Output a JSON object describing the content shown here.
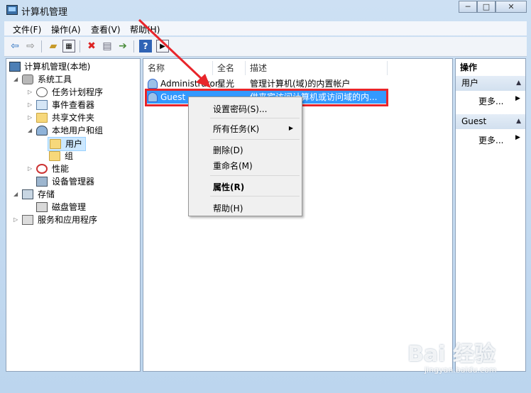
{
  "window": {
    "title": "计算机管理",
    "minimize": "─",
    "maximize": "□",
    "close": "✕"
  },
  "menu": [
    "文件(F)",
    "操作(A)",
    "查看(V)",
    "帮助(H)"
  ],
  "toolbar": [
    "back-arrow-icon",
    "forward-arrow-icon",
    "up-folder-icon",
    "show-tree-icon",
    "delete-icon",
    "properties-icon",
    "export-icon",
    "help-icon",
    "action-pane-icon"
  ],
  "tree": {
    "root": "计算机管理(本地)",
    "system_tools": "系统工具",
    "task_scheduler": "任务计划程序",
    "event_viewer": "事件查看器",
    "shared_folders": "共享文件夹",
    "local_users_groups": "本地用户和组",
    "users": "用户",
    "groups": "组",
    "performance": "性能",
    "device_manager": "设备管理器",
    "storage": "存储",
    "disk_management": "磁盘管理",
    "services_apps": "服务和应用程序"
  },
  "list": {
    "columns": [
      "名称",
      "全名",
      "描述"
    ],
    "rows": [
      {
        "name": "Administrator",
        "fullname": "星光",
        "description": "管理计算机(域)的内置帐户"
      },
      {
        "name": "Guest",
        "fullname": "",
        "description": "供来宾访问计算机或访问域的内..."
      }
    ]
  },
  "actions": {
    "header": "操作",
    "section1": "用户",
    "more1": "更多...",
    "section2": "Guest",
    "more2": "更多..."
  },
  "context_menu": {
    "set_password": "设置密码(S)...",
    "all_tasks": "所有任务(K)",
    "delete": "删除(D)",
    "rename": "重命名(M)",
    "properties": "属性(R)",
    "help": "帮助(H)"
  },
  "watermark": {
    "logo": "Bai 经验",
    "url": "jingyan.baidu.com"
  },
  "colors": {
    "highlight": "#e8252b",
    "accent": "#3399ff"
  }
}
